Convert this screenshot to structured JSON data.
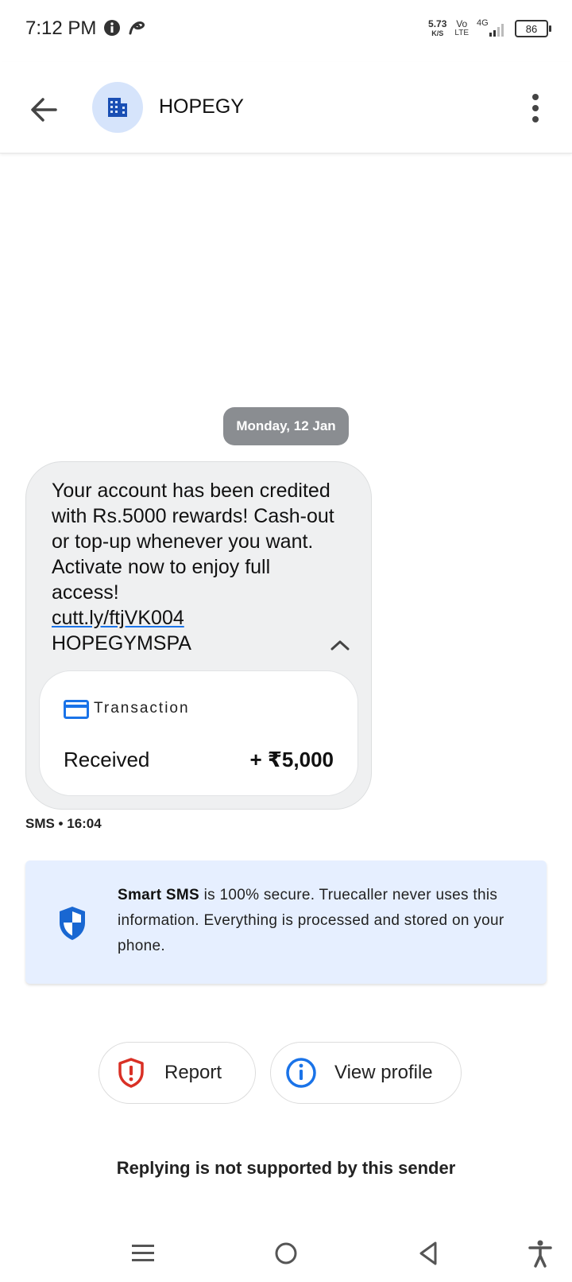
{
  "status_bar": {
    "time": "7:12 PM",
    "net_speed_value": "5.73",
    "net_speed_unit": "K/S",
    "volte_top": "Vo",
    "volte_bottom": "LTE",
    "network": "4G",
    "battery": "86"
  },
  "header": {
    "title": "HOPEGY",
    "avatar_icon": "building-icon",
    "accent_color": "#1a4fb4"
  },
  "conversation": {
    "date_chip": "Monday, 12 Jan",
    "message": {
      "body": "Your account has been credited with Rs.5000 rewards! Cash-out or top-up whenever you want. Activate now to enjoy full access!",
      "link": "cutt.ly/ftjVK004",
      "signature": "HOPEGYMSPA",
      "meta": "SMS • 16:04"
    },
    "transaction": {
      "label": "Transaction",
      "status": "Received",
      "amount": "+ ₹5,000"
    }
  },
  "security_info": {
    "bold": "Smart SMS",
    "text": " is 100% secure. Truecaller never uses this information. Everything is processed and stored on your phone."
  },
  "actions": {
    "report": "Report",
    "view_profile": "View profile"
  },
  "footer_note": "Replying is not supported by this sender",
  "colors": {
    "report_red": "#d93025",
    "info_blue": "#1a73e8",
    "shield_blue": "#1967d2",
    "info_bg": "#e6efff"
  }
}
